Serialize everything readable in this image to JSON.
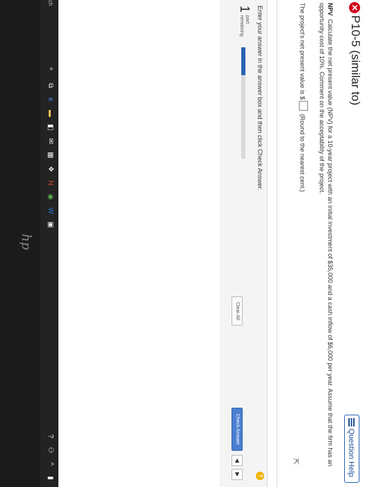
{
  "header": {
    "title": "P10-5 (similar to)",
    "help_label": "Question Help"
  },
  "question": {
    "bold_prefix": "NPV",
    "text": "Calculate the net present value (NPV) for a 10-year project with an initial investment of $35,000 and a cash inflow of $6,000 per year. Assume that the firm has an opportunity cost of 10%. Comment on the acceptability of the project.",
    "answer_prefix": "The project's net present value is $",
    "answer_suffix": "(Round to the nearest cent.)"
  },
  "footer": {
    "instruction": "Enter your answer in the answer box and then click Check Answer.",
    "parts_count": "1",
    "parts_label_1": "part",
    "parts_label_2": "remaining",
    "progress": 0.25,
    "clear_label": "Clear All",
    "check_label": "Check Answer"
  },
  "taskbar": {
    "search_text": "ch"
  },
  "bezel": {
    "logo": "hp"
  },
  "colors": {
    "accent": "#2a62b2",
    "error": "#d0021b",
    "help": "#f0b400"
  }
}
